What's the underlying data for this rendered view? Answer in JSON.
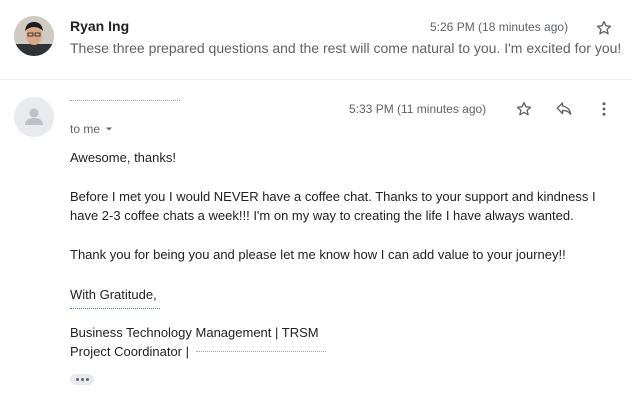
{
  "messages": [
    {
      "sender": "Ryan Ing",
      "time": "5:26 PM (18 minutes ago)",
      "snippet": "These three prepared questions and the rest will come natural to you. I'm excited for you!"
    },
    {
      "time": "5:33 PM (11 minutes ago)",
      "to_label": "to me",
      "body": {
        "greeting": "Awesome, thanks!",
        "p1_line1": "Before I met you I would NEVER have a coffee chat. Thanks to your support and kindness I",
        "p1_line2": "have 2-3 coffee chats a week!!! I'm on my way to creating the life I have always wanted.",
        "p2": "Thank you for being you and please let me know how I can add value to your journey!!",
        "signoff": "With Gratitude,",
        "sig_line1": "Business Technology Management | TRSM",
        "sig_line2": "Project Coordinator |"
      }
    }
  ],
  "icons": {
    "star": "star-outline-icon",
    "reply": "reply-icon",
    "more": "more-vert-icon",
    "expand": "show-trimmed-content-icon"
  },
  "colors": {
    "sender": "#202124",
    "meta": "#5f6368",
    "body": "#222222",
    "divider": "#eceff1"
  }
}
